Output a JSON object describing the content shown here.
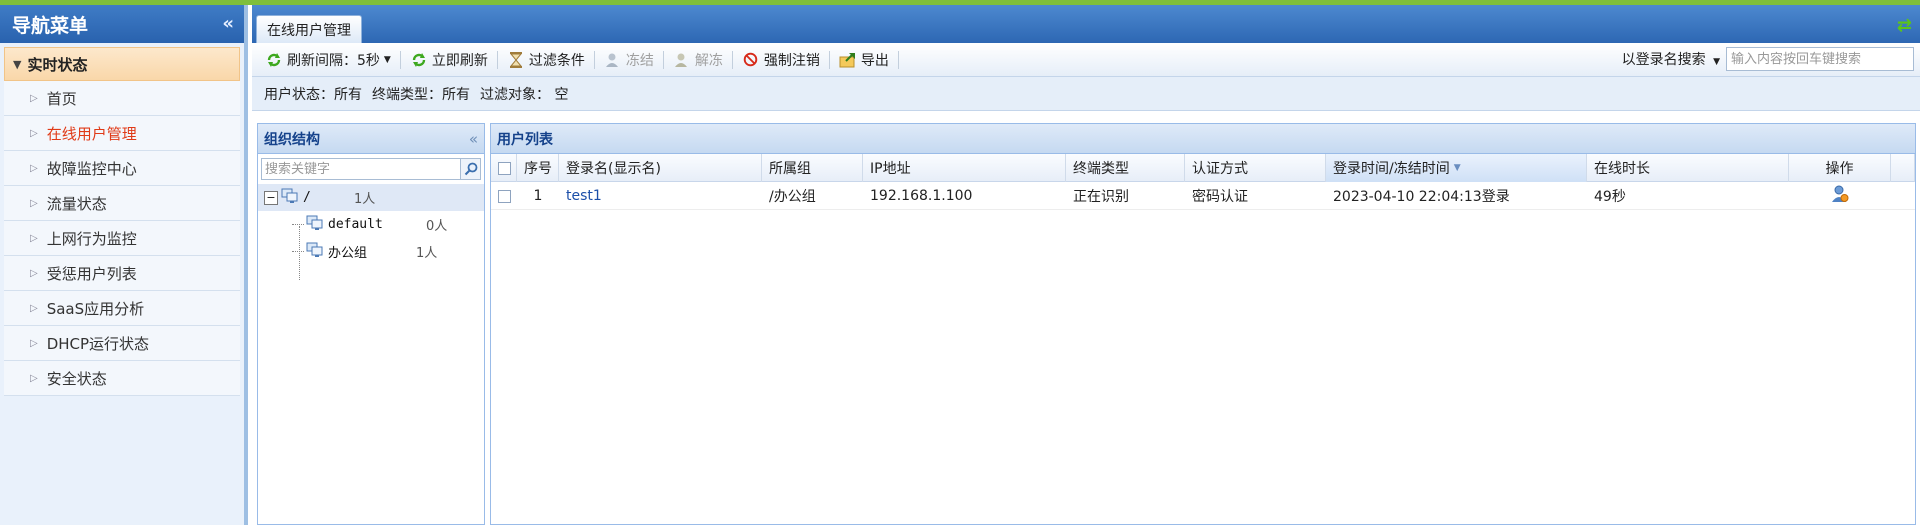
{
  "nav": {
    "title": "导航菜单",
    "section": "实时状态",
    "items": [
      {
        "label": "首页",
        "active": false
      },
      {
        "label": "在线用户管理",
        "active": true
      },
      {
        "label": "故障监控中心",
        "active": false
      },
      {
        "label": "流量状态",
        "active": false
      },
      {
        "label": "上网行为监控",
        "active": false
      },
      {
        "label": "受惩用户列表",
        "active": false
      },
      {
        "label": "SaaS应用分析",
        "active": false
      },
      {
        "label": "DHCP运行状态",
        "active": false
      },
      {
        "label": "安全状态",
        "active": false
      }
    ]
  },
  "tab": {
    "label": "在线用户管理"
  },
  "toolbar": {
    "refresh_interval": "刷新间隔：5秒",
    "refresh_now": "立即刷新",
    "filter": "过滤条件",
    "freeze": "冻结",
    "unfreeze": "解冻",
    "force_logout": "强制注销",
    "export": "导出",
    "search_mode": "以登录名搜索",
    "search_placeholder": "输入内容按回车键搜索"
  },
  "filter_status": {
    "user_status": "用户状态：所有",
    "terminal_type": "终端类型：所有",
    "filter_object": "过滤对象： 空"
  },
  "org": {
    "title": "组织结构",
    "search_placeholder": "搜索关键字",
    "tree": [
      {
        "name": "/",
        "count": "1人"
      },
      {
        "name": "default",
        "count": "0人"
      },
      {
        "name": "办公组",
        "count": "1人"
      }
    ]
  },
  "user_list": {
    "title": "用户列表",
    "columns": [
      "序号",
      "登录名(显示名)",
      "所属组",
      "IP地址",
      "终端类型",
      "认证方式",
      "登录时间/冻结时间",
      "在线时长",
      "操作"
    ],
    "rows": [
      {
        "index": "1",
        "login_name": "test1",
        "group": "/办公组",
        "ip": "192.168.1.100",
        "terminal": "正在识别",
        "auth": "密码认证",
        "login_time": "2023-04-10 22:04:13登录",
        "online_duration": "49秒",
        "action_icon": "user-action-icon"
      }
    ]
  },
  "colors": {
    "header_blue": "#2d67b3",
    "active_red": "#e03a17",
    "link_blue": "#1b4ea8",
    "section_orange": "#f9d7a9"
  }
}
